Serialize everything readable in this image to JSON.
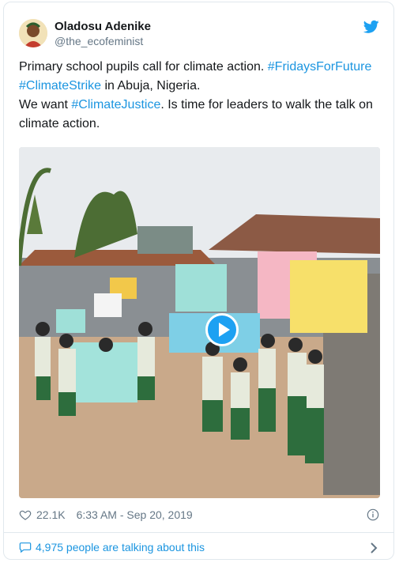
{
  "author": {
    "name": "Oladosu Adenike",
    "handle": "@the_ecofeminist"
  },
  "tweet": {
    "line1_text": "Primary school pupils call for climate action. ",
    "hashtag1": "#FridaysForFuture",
    "hashtag2": "#ClimateStrike",
    "line2_text": " in Abuja, Nigeria.",
    "line3_text": "We want ",
    "hashtag3": "#ClimateJustice",
    "line3_rest": ". Is time for leaders to walk the talk on climate action."
  },
  "meta": {
    "likes": "22.1K",
    "timestamp": "6:33 AM - Sep 20, 2019"
  },
  "footer": {
    "talking_text": "4,975 people are talking about this"
  },
  "colors": {
    "link": "#1b95e0",
    "twitter_blue": "#1da1f2",
    "secondary_text": "#657786"
  },
  "icons": [
    "twitter-bird-icon",
    "play-icon",
    "heart-icon",
    "info-icon",
    "speech-bubble-icon",
    "chevron-right-icon"
  ]
}
